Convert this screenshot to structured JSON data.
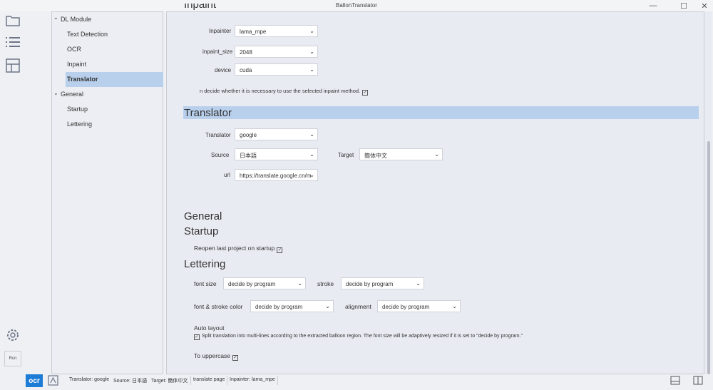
{
  "window": {
    "title": "BallonTranslator",
    "minimize": "—",
    "maximize": "☐",
    "close": "✕"
  },
  "sidebar": {
    "run_label": "Run"
  },
  "nav": {
    "dl_module": "DL Module",
    "items_dl": [
      "Text Detection",
      "OCR",
      "Inpaint",
      "Translator"
    ],
    "general": "General",
    "items_general": [
      "Startup",
      "Lettering"
    ],
    "chevron": "⌄"
  },
  "inpaint": {
    "heading": "Inpaint",
    "inpainter_label": "Inpainter",
    "inpainter_value": "lama_mpe",
    "size_label": "inpaint_size",
    "size_value": "2048",
    "device_label": "device",
    "device_value": "cuda",
    "check_text": "n decide whether it is necessary to use the selected inpaint method."
  },
  "translator": {
    "heading": "Translator",
    "translator_label": "Translator",
    "translator_value": "google",
    "source_label": "Source",
    "source_value": "日本語",
    "target_label": "Target",
    "target_value": "簡体中文",
    "url_label": "url",
    "url_value": "https://translate.google.cn/m"
  },
  "general": {
    "heading": "General",
    "startup_heading": "Startup",
    "reopen_text": "Reopen last project on startup",
    "lettering_heading": "Lettering",
    "font_size_label": "font size",
    "font_size_value": "decide by program",
    "stroke_label": "stroke",
    "stroke_value": "decide by program",
    "color_label": "font & stroke color",
    "color_value": "decide by program",
    "alignment_label": "alignment",
    "alignment_value": "decide by program",
    "auto_layout_label": "Auto layout",
    "auto_layout_text": "Split translation into multi-lines according to the extracted balloon region. The font size will be adaptively resized if it is set to \"decide by program.\"",
    "uppercase_text": "To uppercase"
  },
  "statusbar": {
    "ocr": "ocr",
    "translator": "Translator: google",
    "source": "Source: 日本語",
    "target": "Target: 簡体中文",
    "translate_page": "translate page",
    "inpainter": "Inpainter: lama_mpe"
  },
  "colors": {
    "accent": "#1c7cd6",
    "selection": "#b9d0ec"
  }
}
